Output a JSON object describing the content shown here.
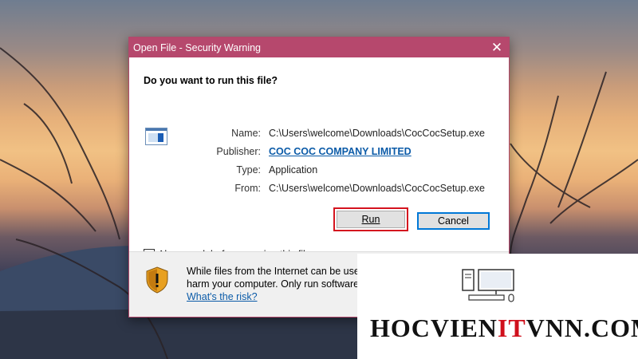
{
  "dialog": {
    "title": "Open File - Security Warning",
    "close_glyph": "✕",
    "question": "Do you want to run this file?",
    "fields": [
      {
        "label": "Name:",
        "value": "C:\\Users\\welcome\\Downloads\\CocCocSetup.exe"
      },
      {
        "label": "Publisher:",
        "value": "COC COC COMPANY LIMITED"
      },
      {
        "label": "Type:",
        "value": "Application"
      },
      {
        "label": "From:",
        "value": "C:\\Users\\welcome\\Downloads\\CocCocSetup.exe"
      }
    ],
    "run_label": "Run",
    "cancel_label": "Cancel",
    "checkbox_label": "Always ask before opening this file",
    "checkbox_checked": true,
    "warning_line1": "While files from the Internet can be usef",
    "warning_line2": "harm your computer. Only run software",
    "risk_link": "What's the risk?"
  },
  "icons": [
    "application-file-icon",
    "security-shield-icon",
    "computer-logo-icon"
  ],
  "colors": {
    "titlebar": "#b6486d",
    "highlight": "#d4141f",
    "link": "#0b5ba8",
    "logo_accent": "#d0101c"
  },
  "watermark": {
    "brand_part1": "HOCVIEN",
    "brand_part2": "IT",
    "brand_part3": "VNN.COM"
  }
}
